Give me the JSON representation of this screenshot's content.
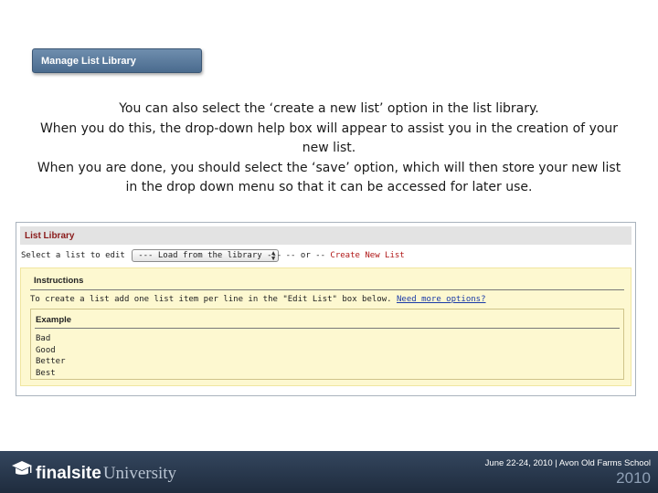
{
  "manage_button": {
    "label": "Manage List Library"
  },
  "instructions_text": [
    "You can also select the ‘create a new list’ option in the list library.",
    "When you do this, the drop-down help box will appear to assist you in the creation of your new list.",
    "When you are done, you should select the ‘save’ option, which will then store your new list in the drop down menu so that it can be accessed for later use."
  ],
  "list_library": {
    "header": "List Library",
    "select_label": "Select a list to edit",
    "select_value": "--- Load from the library ---",
    "or_text": "-- or --",
    "create_link": "Create New List",
    "help": {
      "instructions_title": "Instructions",
      "instructions_text": "To create a list add one list item per line in the \"Edit List\" box below.",
      "more_link": "Need more options?",
      "example_title": "Example",
      "example_items": [
        "Bad",
        "Good",
        "Better",
        "Best"
      ]
    }
  },
  "footer": {
    "logo_bold": "finalsite",
    "logo_light": "University",
    "event_line": "June 22-24, 2010 | Avon Old Farms School",
    "year": "2010"
  },
  "colors": {
    "footer_bg": "#2a3a50",
    "help_bg": "#fdf8d0",
    "link_red": "#b01818",
    "button_blue": "#5a7a9c"
  },
  "icons": {
    "logo": "graduation-cap-icon",
    "select_arrows": "up-down-arrows-icon"
  }
}
